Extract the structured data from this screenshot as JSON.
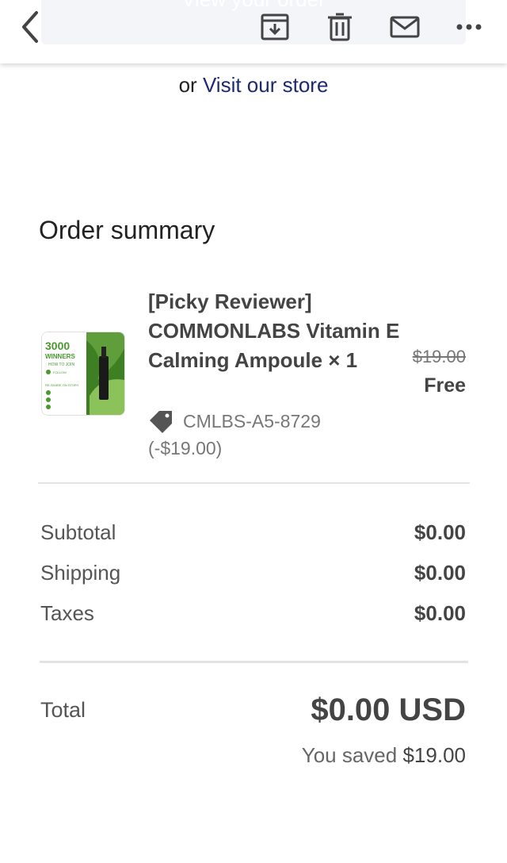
{
  "toolbar": {
    "view_order_label": "View your order",
    "icons": [
      "back-icon",
      "archive-icon",
      "trash-icon",
      "mail-icon",
      "more-icon"
    ]
  },
  "store_link": {
    "prefix": "or",
    "link_text": "Visit our store"
  },
  "order_summary": {
    "title": "Order summary",
    "product": {
      "name_line1": "[Picky Reviewer]",
      "name_rest": "COMMONLABS Vitamin E Calming Ampoule × 1",
      "original_price": "$19.00",
      "final_price": "Free",
      "discount_code": "CMLBS-A5-8729 (-$19.00)",
      "thumbnail_text": [
        "3000",
        "WINNERS",
        "HOW TO JOIN",
        "FOLLOW",
        "RE-SHARE ON STORY"
      ]
    },
    "rows": [
      {
        "label": "Subtotal",
        "value": "$0.00"
      },
      {
        "label": "Shipping",
        "value": "$0.00"
      },
      {
        "label": "Taxes",
        "value": "$0.00"
      }
    ],
    "total_label": "Total",
    "total_value": "$0.00 USD",
    "saved_prefix": "You saved",
    "saved_amount": "$19.00"
  },
  "colors": {
    "link": "#1d2a70",
    "text": "#444444",
    "muted": "#777777",
    "divider": "#e3e3e3",
    "thumb_green": "#4a9a2e"
  }
}
